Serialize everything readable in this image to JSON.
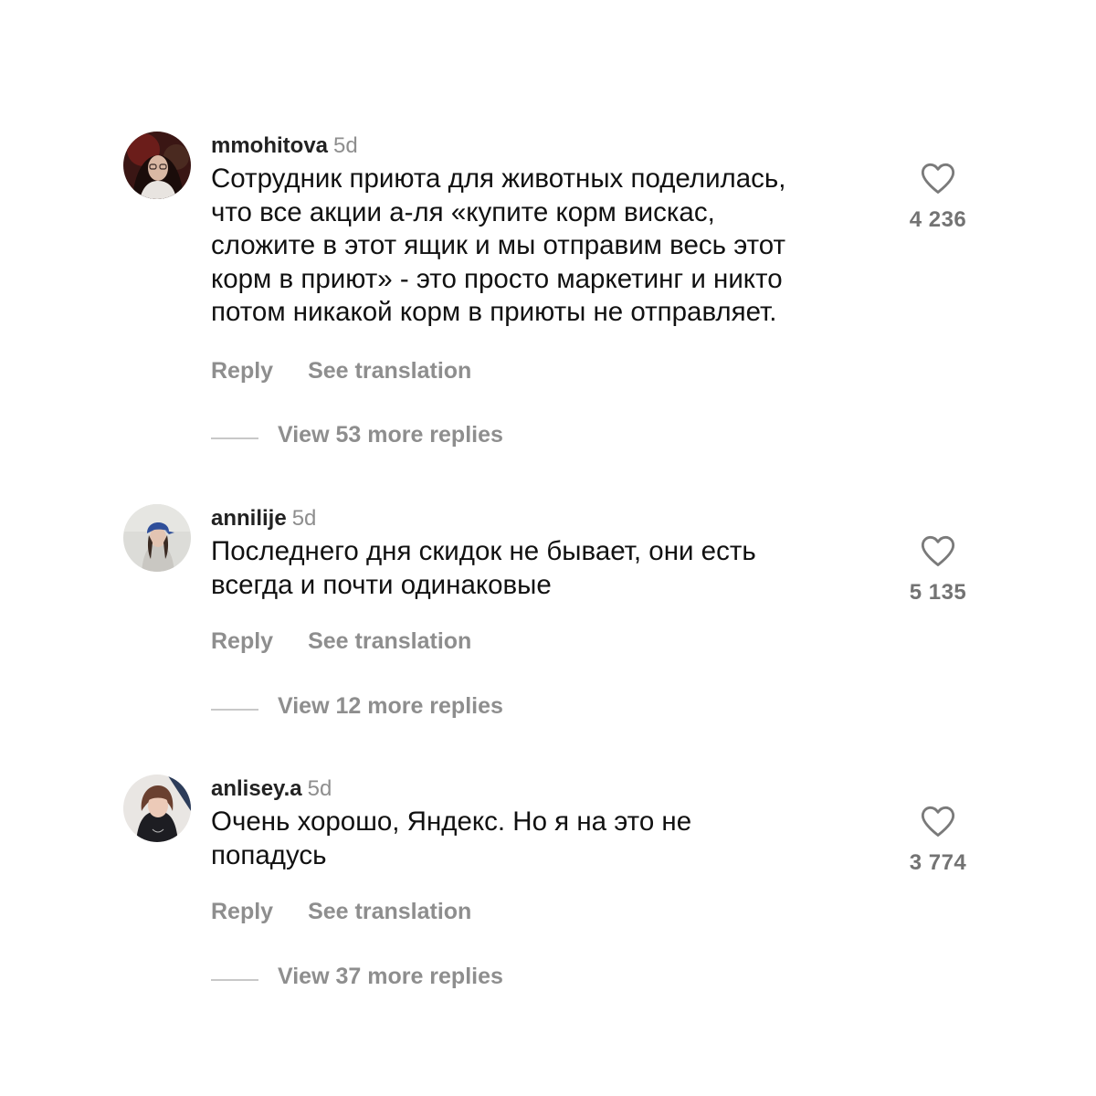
{
  "colors": {
    "text": "#111111",
    "secondary": "#8e8e8e",
    "divider": "#c8c8c8"
  },
  "comments": [
    {
      "username": "mmohitova",
      "time": "5d",
      "text": "Сотрудник приюта для животных поделилась,\nчто все акции а-ля «купите корм вискас,\nсложите в этот ящик и мы отправим весь этот\nкорм в приют» - это просто маркетинг и никто\nпотом никакой корм в приюты не отправляет.",
      "likes": "4 236",
      "reply_label": "Reply",
      "translate_label": "See translation",
      "replies_label": "View 53 more replies",
      "avatar_icon": "profile-photo-icon",
      "like_icon": "heart-outline-icon"
    },
    {
      "username": "annilije",
      "time": "5d",
      "text": "Последнего дня скидок не бывает, они есть\nвсегда и почти одинаковые",
      "likes": "5 135",
      "reply_label": "Reply",
      "translate_label": "See translation",
      "replies_label": "View 12 more replies",
      "avatar_icon": "profile-photo-icon",
      "like_icon": "heart-outline-icon"
    },
    {
      "username": "anlisey.a",
      "time": "5d",
      "text": "Очень хорошо, Яндекс. Но я на это не\nпопадусь",
      "likes": "3 774",
      "reply_label": "Reply",
      "translate_label": "See translation",
      "replies_label": "View 37 more replies",
      "avatar_icon": "profile-photo-icon",
      "like_icon": "heart-outline-icon"
    }
  ]
}
